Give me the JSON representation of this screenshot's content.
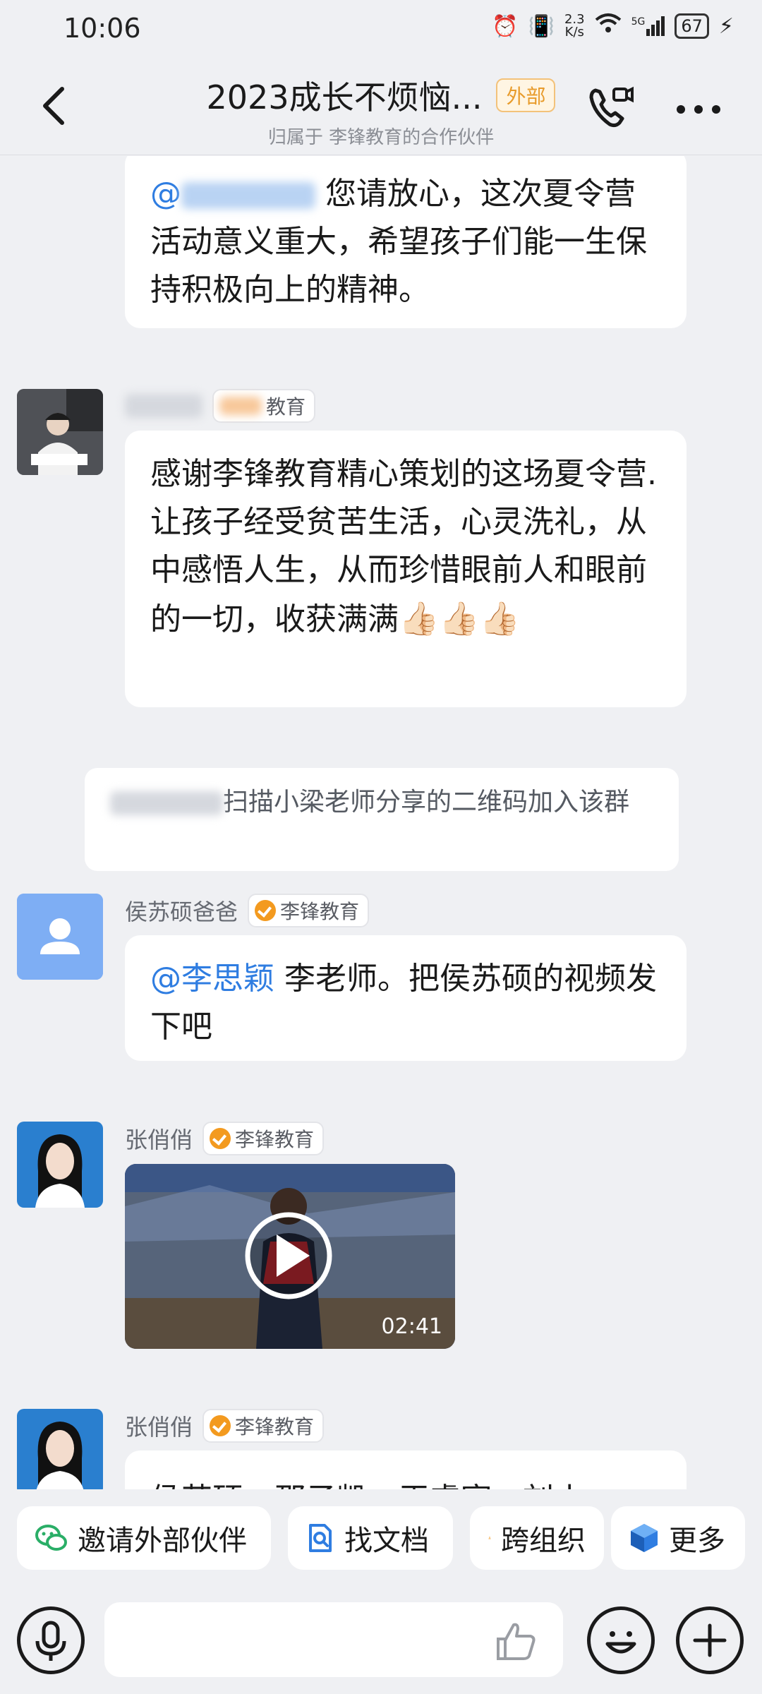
{
  "status_bar": {
    "time": "10:06",
    "speed_value": "2.3",
    "speed_unit": "K/s",
    "network": "5G",
    "battery": "67"
  },
  "header": {
    "title": "2023成长不烦恼...",
    "badge": "外部",
    "subtitle": "归属于 李锋教育的合作伙伴"
  },
  "messages": [
    {
      "mention": "@",
      "text": "您请放心，这次夏令营活动意义重大，希望孩子们能一生保持积极向上的精神。"
    },
    {
      "sender_org": "教育",
      "text": "感谢李锋教育精心策划的这场夏令营.让孩子经受贫苦生活，心灵洗礼，从中感悟人生，从而珍惜眼前人和眼前的一切，收获满满",
      "emojis": "👍🏻👍🏻👍🏻"
    },
    {
      "system": "扫描小梁老师分享的二维码加入该群"
    },
    {
      "sender_name": "侯苏硕爸爸",
      "sender_org": "李锋教育",
      "mention": "@李思颖",
      "text": "李老师。把侯苏硕的视频发下吧"
    },
    {
      "sender_name": "张俏俏",
      "sender_org": "李锋教育",
      "video_duration": "02:41"
    },
    {
      "sender_name": "张俏俏",
      "sender_org": "李锋教育",
      "text": "侯苏硕、邵子凯、王睿宸、刘小"
    }
  ],
  "quick_actions": [
    "邀请外部伙伴",
    "找文档",
    "跨组织",
    "更多"
  ],
  "colors": {
    "background": "#eff0f3",
    "mention": "#2f7de1",
    "badge_orange": "#f39a1f"
  }
}
